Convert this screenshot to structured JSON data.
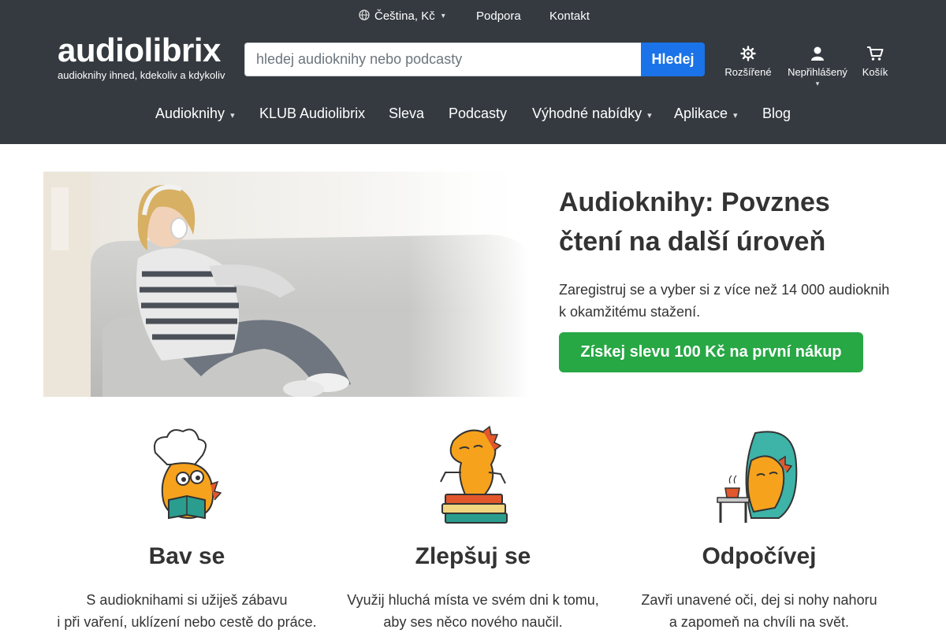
{
  "topbar": {
    "language_label": "Čeština, Kč",
    "support_label": "Podpora",
    "contact_label": "Kontakt"
  },
  "logo": {
    "wordmark": "audiolibrix",
    "tagline": "audioknihy ihned, kdekoliv a kdykoliv"
  },
  "search": {
    "placeholder": "hledej audioknihy nebo podcasty",
    "value": "",
    "button_label": "Hledej"
  },
  "header_actions": [
    {
      "label": "Rozšířené",
      "icon": "gear-icon"
    },
    {
      "label": "Nepřihlášený",
      "icon": "user-icon"
    },
    {
      "label": "Košík",
      "icon": "cart-icon"
    }
  ],
  "nav": {
    "items": [
      {
        "label": "Audioknihy",
        "dropdown": true
      },
      {
        "label": "KLUB Audiolibrix",
        "dropdown": false
      },
      {
        "label": "Sleva",
        "dropdown": false
      },
      {
        "label": "Podcasty",
        "dropdown": false
      },
      {
        "label": "Výhodné nabídky",
        "dropdown": true
      },
      {
        "label": "Aplikace",
        "dropdown": true
      },
      {
        "label": "Blog",
        "dropdown": false
      }
    ]
  },
  "hero": {
    "title": "Audioknihy: Povznes čtení na další úroveň",
    "description": "Zaregistruj se a vyber si z více než 14 000 audioknih k okamžitému stažení.",
    "cta_label": "Získej slevu 100 Kč na první nákup"
  },
  "features": [
    {
      "title": "Bav se",
      "line1": "S audioknihami si užiješ zábavu",
      "line2": "i při vaření, uklízení nebo cestě do práce."
    },
    {
      "title": "Zlepšuj se",
      "line1": "Využij hluchá místa ve svém dni k tomu,",
      "line2": "aby ses něco nového naučil."
    },
    {
      "title": "Odpočívej",
      "line1": "Zavři unavené oči, dej si nohy nahoru",
      "line2": "a zapomeň na chvíli na svět."
    }
  ],
  "colors": {
    "header_bg": "#343a40",
    "search_button": "#1a73e8",
    "cta": "#28a745",
    "mascot": "#f6a21d"
  }
}
